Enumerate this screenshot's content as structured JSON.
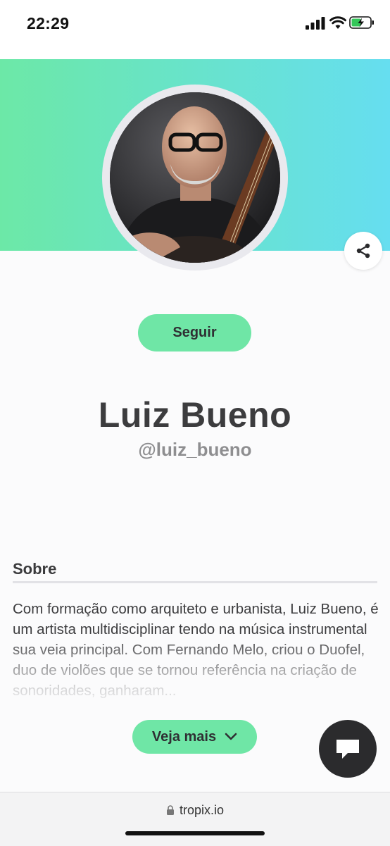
{
  "status": {
    "time": "22:29",
    "signal_icon": "cellular-signal-icon",
    "wifi_icon": "wifi-icon",
    "battery_icon": "battery-charging-icon"
  },
  "profile": {
    "banner_gradient": [
      "#6ce8a7",
      "#66def0"
    ],
    "avatar_alt": "profile photo",
    "follow_label": "Seguir",
    "name": "Luiz Bueno",
    "handle": "@luiz_bueno",
    "share_icon": "share-icon"
  },
  "about": {
    "title": "Sobre",
    "text": "Com formação como arquiteto e urbanista, Luiz Bueno, é um artista multidisciplinar tendo na música instrumental sua veia principal. Com Fernando Melo, criou o Duofel, duo de violões que se tornou referência na criação de sonoridades, ganharam...",
    "see_more_label": "Veja mais",
    "see_more_icon": "chevron-down-icon"
  },
  "chat": {
    "icon": "chat-bubble-icon"
  },
  "browser": {
    "url": "tropix.io",
    "lock_icon": "lock-icon"
  },
  "colors": {
    "accent": "#6fe6a6",
    "chat_button": "#2b2b2d",
    "text_dark": "#3c3c3e",
    "text_muted": "#8e8e90"
  }
}
